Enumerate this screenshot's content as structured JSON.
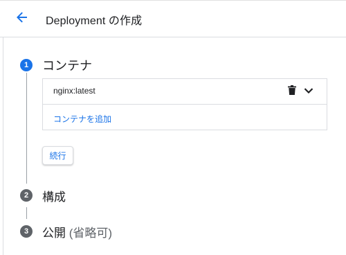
{
  "header": {
    "title": "Deployment の作成",
    "back_icon": "arrow-back-icon",
    "accent_color": "#1a73e8"
  },
  "steps": [
    {
      "number": "1",
      "label": "コンテナ",
      "state": "active"
    },
    {
      "number": "2",
      "label": "構成",
      "state": "inactive"
    },
    {
      "number": "3",
      "label": "公開",
      "optional": "(省略可)",
      "state": "inactive"
    }
  ],
  "containers": {
    "items": [
      {
        "name": "nginx:latest",
        "delete_icon": "trash-icon",
        "expand_icon": "chevron-down-icon"
      }
    ],
    "add_label": "コンテナを追加"
  },
  "continue_label": "続行"
}
